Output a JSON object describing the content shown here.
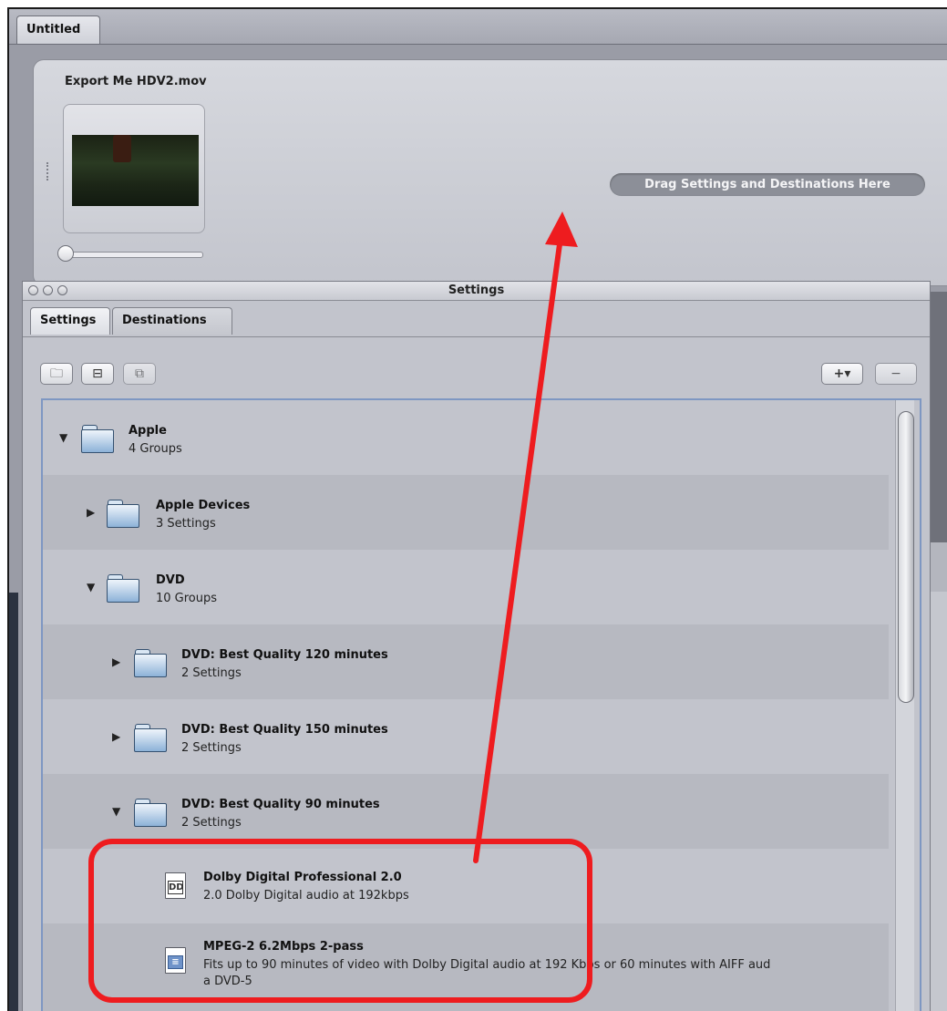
{
  "top_tab": {
    "label": "Untitled"
  },
  "batch": {
    "title": "Export Me HDV2.mov",
    "drop_hint": "Drag Settings and Destinations Here"
  },
  "settings_window": {
    "title": "Settings",
    "tabs": [
      {
        "label": "Settings",
        "active": true
      },
      {
        "label": "Destinations",
        "active": false
      }
    ],
    "toolbar": {
      "new_group_icon": "new-folder-icon",
      "import_icon": "import-icon",
      "duplicate_icon": "duplicate-icon",
      "add_label": "+▾",
      "remove_label": "−"
    },
    "items": [
      {
        "title": "Apple",
        "subtitle": "4 Groups",
        "icon": "folder-icon",
        "expanded": true
      },
      {
        "title": "Apple Devices",
        "subtitle": "3 Settings",
        "icon": "folder-icon",
        "expanded": false
      },
      {
        "title": "DVD",
        "subtitle": "10 Groups",
        "icon": "folder-icon",
        "expanded": true
      },
      {
        "title": "DVD: Best Quality 120 minutes",
        "subtitle": "2 Settings",
        "icon": "folder-icon",
        "expanded": false
      },
      {
        "title": "DVD: Best Quality 150 minutes",
        "subtitle": "2 Settings",
        "icon": "folder-icon",
        "expanded": false
      },
      {
        "title": "DVD: Best Quality 90 minutes",
        "subtitle": "2 Settings",
        "icon": "folder-icon",
        "expanded": true
      },
      {
        "title": "Dolby Digital Professional 2.0",
        "subtitle": "2.0 Dolby Digital audio at 192kbps",
        "icon": "dolby-file-icon",
        "badge": "DD"
      },
      {
        "title": "MPEG-2 6.2Mbps 2-pass",
        "subtitle": "Fits up to 90 minutes of video with Dolby Digital audio at 192 Kbps or 60 minutes with AIFF aud",
        "subtitle2": "a DVD-5",
        "icon": "mpeg-file-icon",
        "badge": "≡"
      }
    ]
  },
  "annotation": {
    "color": "#ee1c1f"
  }
}
